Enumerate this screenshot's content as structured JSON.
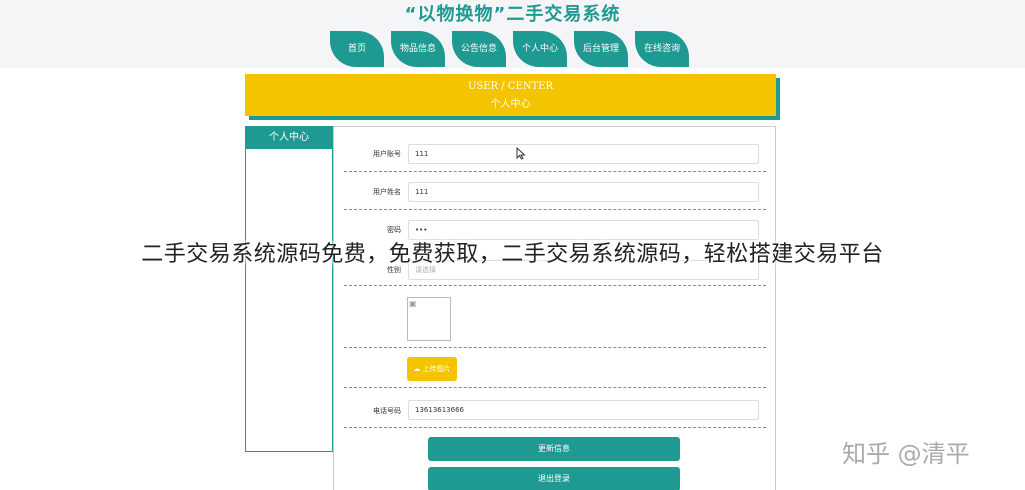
{
  "site": {
    "title": "“以物换物”二手交易系统"
  },
  "nav": {
    "items": [
      {
        "label": "首页"
      },
      {
        "label": "物品信息"
      },
      {
        "label": "公告信息"
      },
      {
        "label": "个人中心"
      },
      {
        "label": "后台管理"
      },
      {
        "label": "在线咨询"
      }
    ]
  },
  "banner": {
    "en": "USER / CENTER",
    "cn": "个人中心"
  },
  "sidebar": {
    "title": "个人中心"
  },
  "form": {
    "account": {
      "label": "用户账号",
      "value": "111"
    },
    "name": {
      "label": "用户姓名",
      "value": "111"
    },
    "password": {
      "label": "密码",
      "value": "•••"
    },
    "gender": {
      "label": "性别",
      "placeholder": "请选择"
    },
    "upload_label": "上传图片",
    "phone": {
      "label": "电话号码",
      "value": "13613613666"
    },
    "update_label": "更新信息",
    "logout_label": "退出登录"
  },
  "overlay": {
    "text": "二手交易系统源码免费，免费获取，二手交易系统源码，轻松搭建交易平台"
  },
  "watermark": {
    "text": "知乎 @清平"
  },
  "colors": {
    "teal": "#1e9a92",
    "yellow": "#f5c400"
  },
  "icons": {
    "upload": "cloud-upload-icon",
    "image": "broken-image-icon",
    "cursor": "cursor-icon"
  }
}
